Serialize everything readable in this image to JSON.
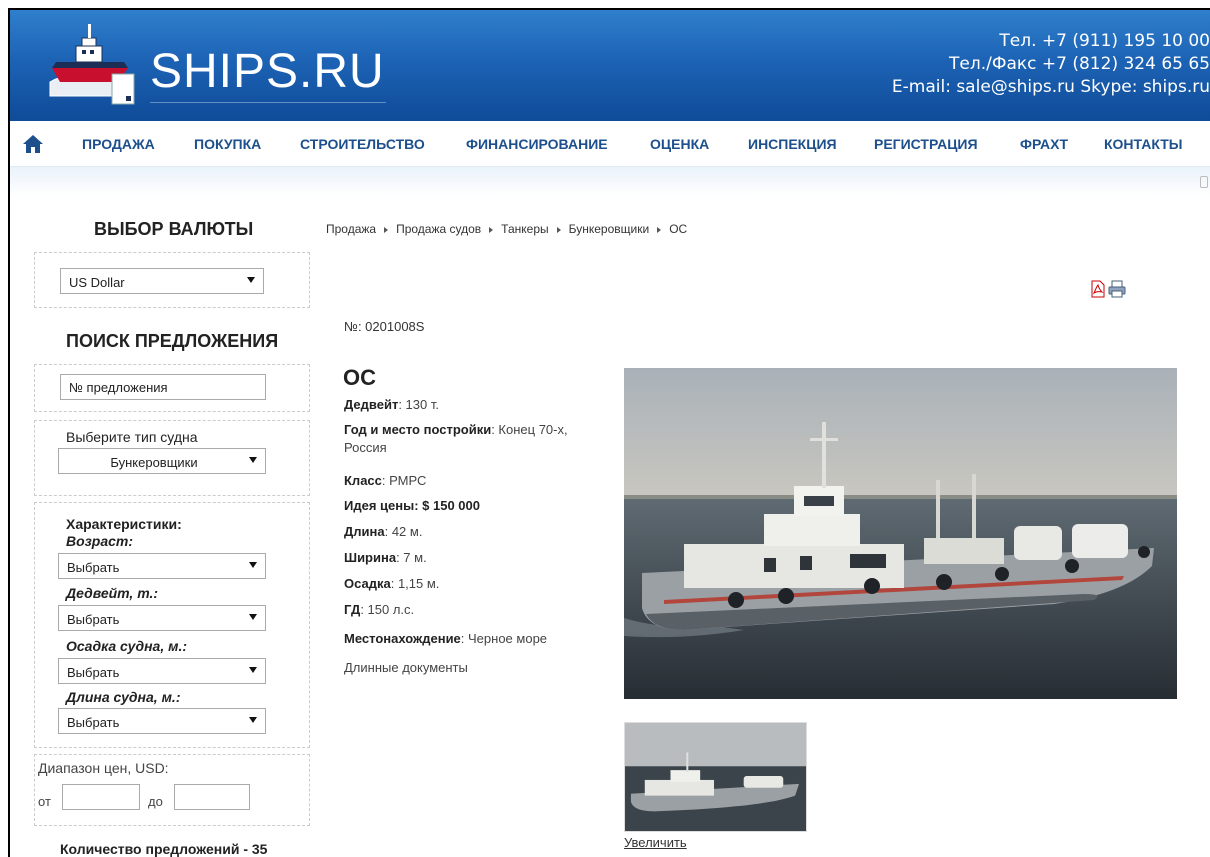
{
  "header": {
    "logo_text": "SHIPS.RU",
    "phone": "Тел. +7 (911) 195 10 00",
    "phone_fax": "Тел./Факс +7 (812) 324 65 65",
    "email_skype": "E-mail: sale@ships.ru  Skype: ships.ru"
  },
  "nav": {
    "home_icon": "home-icon",
    "items": [
      "ПРОДАЖА",
      "ПОКУПКА",
      "СТРОИТЕЛЬСТВО",
      "ФИНАНСИРОВАНИЕ",
      "ОЦЕНКА",
      "ИНСПЕКЦИЯ",
      "РЕГИСТРАЦИЯ",
      "ФРАХТ",
      "КОНТАКТЫ"
    ]
  },
  "sidebar": {
    "currency_title": "ВЫБОР ВАЛЮТЫ",
    "currency_selected": "US Dollar",
    "search_title": "ПОИСК ПРЕДЛОЖЕНИЯ",
    "offer_number_placeholder": "№ предложения",
    "ship_type_label": "Выберите тип судна",
    "ship_type_selected": "Бункеровщики",
    "characteristics_label": "Характеристики:",
    "age_label": "Возраст:",
    "age_selected": "Выбрать",
    "deadweight_label": "Дедвейт, т.:",
    "deadweight_selected": "Выбрать",
    "draft_label": "Осадка судна, м.:",
    "draft_selected": "Выбрать",
    "length_label": "Длина судна, м.:",
    "length_selected": "Выбрать",
    "price_range_label": "Диапазон цен, USD:",
    "price_from_label": "от",
    "price_to_label": "до",
    "offers_count": "Количество предложений - 35"
  },
  "breadcrumb": [
    "Продажа",
    "Продажа судов",
    "Танкеры",
    "Бункеровщики",
    "ОС"
  ],
  "toolbar": {
    "pdf_icon": "pdf-icon",
    "print_icon": "printer-icon"
  },
  "listing": {
    "offer_no": "№: 0201008S",
    "name": "ОС",
    "deadweight_key": "Дедвейт",
    "deadweight_val": ": 130 т.",
    "build_key": "Год и место постройки",
    "build_val": ": Конец 70-х, Россия",
    "class_key": "Класс",
    "class_val": ": РМРС",
    "price": "Идея цены: $ 150 000",
    "length_key": "Длина",
    "length_val": ": 42 м.",
    "width_key": "Ширина",
    "width_val": ": 7 м.",
    "draft_key": "Осадка",
    "draft_val": ": 1,15 м.",
    "engine_key": "ГД",
    "engine_val": ": 150 л.с.",
    "location_key": "Местонахождение",
    "location_val": ": Черное море",
    "docs_link": "Длинные документы",
    "enlarge_link": "Увеличить"
  },
  "colors": {
    "header_top": "#2f7fcc",
    "header_bottom": "#0f4b98",
    "nav_text": "#1c4f8c"
  }
}
